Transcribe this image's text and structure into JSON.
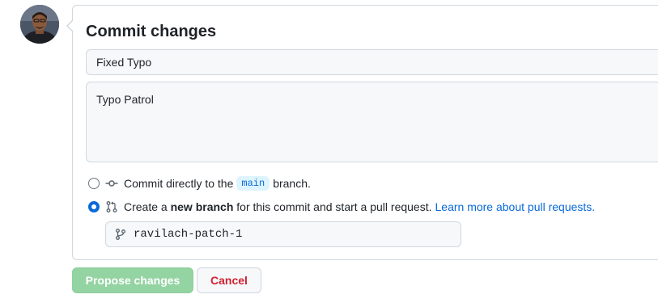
{
  "commit_panel": {
    "title": "Commit changes",
    "summary_value": "Fixed Typo",
    "description_value": "Typo Patrol",
    "option_direct": {
      "prefix": "Commit directly to the",
      "branch": "main",
      "suffix": "branch.",
      "selected": false
    },
    "option_new_branch": {
      "prefix": "Create a",
      "bold": "new branch",
      "suffix": "for this commit and start a pull request.",
      "link": "Learn more about pull requests.",
      "selected": true
    },
    "branch_name_value": "ravilach-patch-1"
  },
  "actions": {
    "propose_label": "Propose changes",
    "cancel_label": "Cancel"
  },
  "colors": {
    "accent": "#0969da",
    "propose_disabled": "#94d3a2",
    "danger": "#cf222e"
  },
  "icons": {
    "commit": "git-commit-icon",
    "pull_request": "git-pull-request-icon",
    "branch": "git-branch-icon"
  }
}
